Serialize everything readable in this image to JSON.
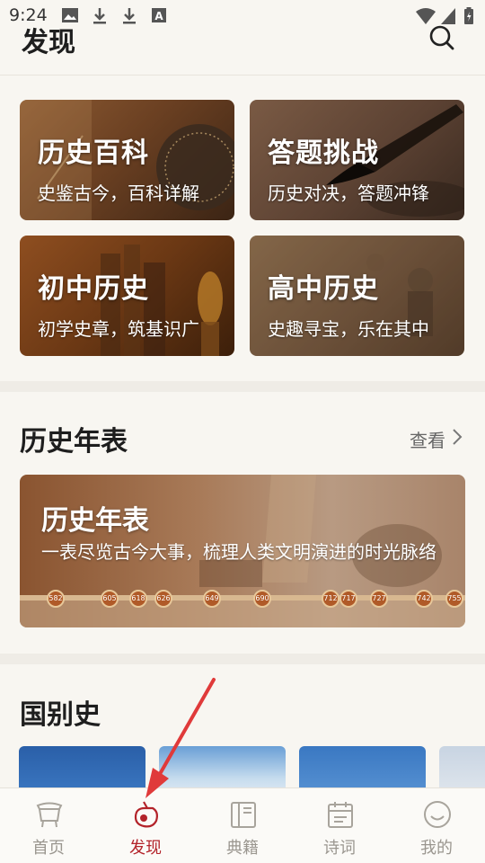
{
  "status_bar": {
    "time": "9:24"
  },
  "header": {
    "title": "发现"
  },
  "feature_cards": [
    {
      "title": "历史百科",
      "subtitle": "史鉴古今，百科详解"
    },
    {
      "title": "答题挑战",
      "subtitle": "历史对决，答题冲锋"
    },
    {
      "title": "初中历史",
      "subtitle": "初学史章，筑基识广"
    },
    {
      "title": "高中历史",
      "subtitle": "史趣寻宝，乐在其中"
    }
  ],
  "timeline_section": {
    "heading": "历史年表",
    "view_more": "查看",
    "card": {
      "title": "历史年表",
      "description": "一表尽览古今大事，梳理人类文明演进的时光脉络",
      "years": [
        "582",
        "605",
        "618",
        "626",
        "649",
        "690",
        "712",
        "717",
        "727",
        "742",
        "755"
      ]
    }
  },
  "country_section": {
    "heading": "国别史"
  },
  "bottom_nav": {
    "items": [
      {
        "label": "首页",
        "icon": "home-icon"
      },
      {
        "label": "发现",
        "icon": "discover-icon"
      },
      {
        "label": "典籍",
        "icon": "book-icon"
      },
      {
        "label": "诗词",
        "icon": "calendar-icon"
      },
      {
        "label": "我的",
        "icon": "profile-icon"
      }
    ],
    "active_index": 1
  },
  "colors": {
    "accent": "#b3232a",
    "background": "#f8f6f1",
    "inactive": "#9a968f"
  }
}
